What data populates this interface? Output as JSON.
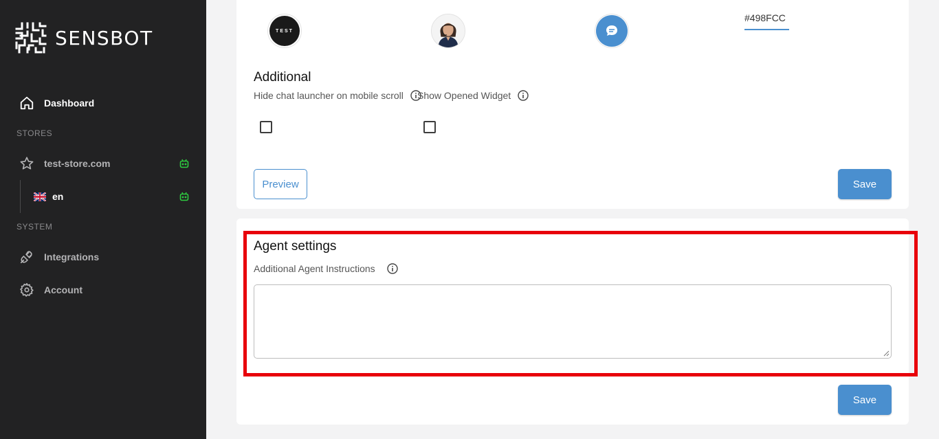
{
  "sidebar": {
    "brand": "SENSBOT",
    "dashboard_label": "Dashboard",
    "stores_section": "STORES",
    "store_name": "test-store.com",
    "store_language": "en",
    "system_section": "SYSTEM",
    "integrations_label": "Integrations",
    "account_label": "Account"
  },
  "appearance": {
    "logo_avatar_text": "TEST",
    "accent_color_value": "#498FCC"
  },
  "additional": {
    "title": "Additional",
    "hide_launcher_label": "Hide chat launcher on mobile scroll",
    "show_opened_label": "Show Opened Widget",
    "hide_launcher_checked": false,
    "show_opened_checked": false,
    "preview_label": "Preview",
    "save_label": "Save"
  },
  "agent": {
    "title": "Agent settings",
    "instructions_label": "Additional Agent Instructions",
    "instructions_value": "",
    "save_label": "Save"
  },
  "colors": {
    "sidebar_bg": "#222223",
    "accent": "#4a8fcf",
    "highlight": "#e8000b",
    "bot_status": "#2ecc40"
  }
}
